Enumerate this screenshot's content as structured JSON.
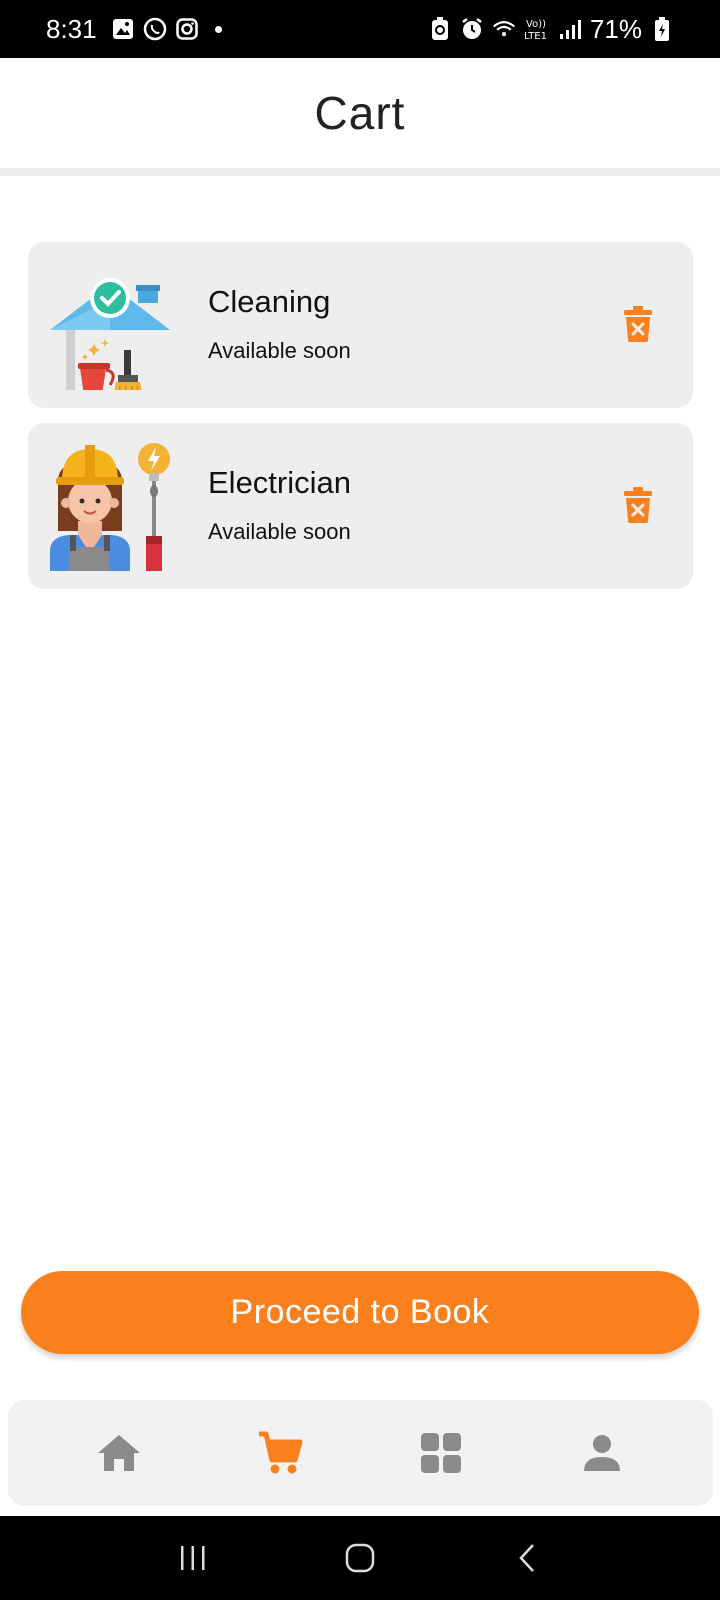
{
  "status_bar": {
    "time": "8:31",
    "battery": "71%"
  },
  "header": {
    "title": "Cart"
  },
  "cart": {
    "items": [
      {
        "title": "Cleaning",
        "subtitle": "Available soon",
        "icon": "cleaning-illustration-icon"
      },
      {
        "title": "Electrician",
        "subtitle": "Available soon",
        "icon": "electrician-illustration-icon"
      }
    ]
  },
  "actions": {
    "proceed_label": "Proceed to Book"
  },
  "bottom_nav": {
    "items": [
      {
        "icon": "home-icon",
        "active": false
      },
      {
        "icon": "cart-icon",
        "active": true
      },
      {
        "icon": "grid-icon",
        "active": false
      },
      {
        "icon": "profile-icon",
        "active": false
      }
    ]
  },
  "colors": {
    "accent": "#fa801d",
    "card_bg": "#eeeeee",
    "nav_inactive": "#8a8a8a"
  }
}
